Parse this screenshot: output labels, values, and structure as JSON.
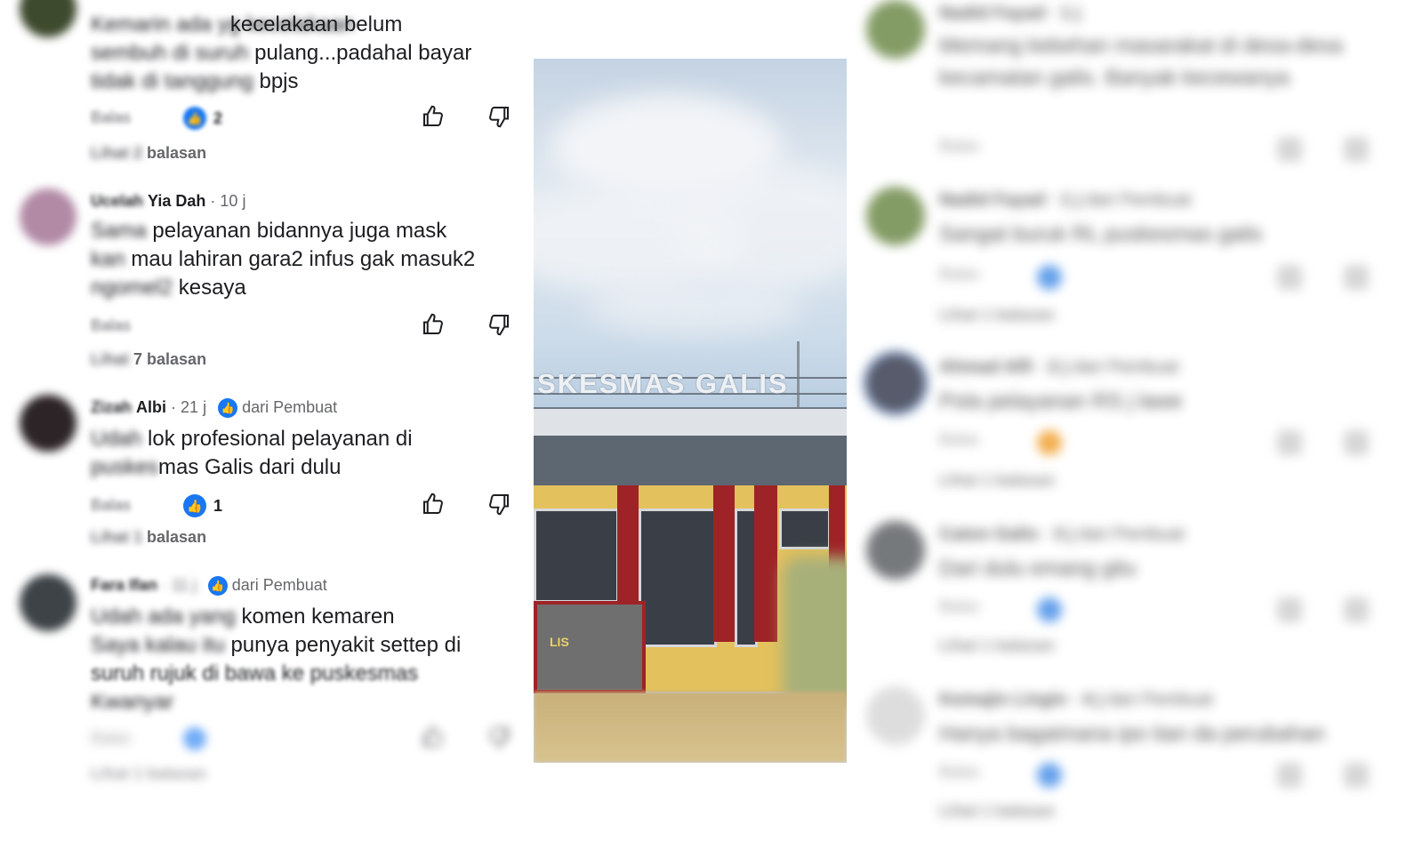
{
  "colors": {
    "accent": "#1877f2",
    "text": "#1c1e21",
    "muted": "#65676b"
  },
  "left_comments": [
    {
      "name": "",
      "time": "",
      "author_badge": "",
      "text_blur": "Kemarin ada yg kecelakaan",
      "text_clear_1": "kecelakaan belum",
      "text_blur_2": "sembuh di suruh",
      "text_clear_2": "pulang...padahal bayar",
      "text_blur_3": "tidak di tanggung",
      "text_clear_3": "bpjs",
      "reply_label": "Balas",
      "reaction_count": "2",
      "replies_blur": "Lihat 2",
      "replies_clear": "balasan"
    },
    {
      "name_blur": "Ucelah",
      "name_clear": "Yia Dah",
      "time": "· 10 j",
      "text_blur": "Sama",
      "text_clear_1": "pelayanan bidannya juga mask",
      "text_blur_2": "kan",
      "text_clear_2": "mau lahiran gara2 infus gak masuk2",
      "text_blur_3": "ngomel2",
      "text_clear_3": "kesaya",
      "reply_label": "Balas",
      "replies_blur": "Lihat",
      "replies_clear": "7 balasan"
    },
    {
      "name_blur": "Zizah",
      "name_clear": "Albi",
      "time": "· 21 j",
      "author_badge": "dari Pembuat",
      "text_blur": "Udah",
      "text_clear_1": "lok profesional pelayanan di",
      "text_blur_2": "puskes",
      "text_clear_2": "mas Galis dari dulu",
      "reply_label": "Balas",
      "reaction_count": "1",
      "replies_blur": "Lihat 1",
      "replies_clear": "balasan"
    },
    {
      "name_blur": "Fara Ifan",
      "time_blur": "· 11 j",
      "author_badge": "dari Pembuat",
      "text_blur": "Udah ada yang",
      "text_clear_1": "komen kemaren",
      "text_blur_2": "Saya kalau itu",
      "text_clear_2": "punya penyakit settep di",
      "text_blur_3": "suruh rujuk di bawa ke puskesmas",
      "text_clear_3": "",
      "text_blur_4": "Kwanyar",
      "reply_label": "Balas",
      "replies_blur": "Lihat 1 balasan"
    }
  ],
  "photo": {
    "sign_text": "SKESMAS GALIS",
    "plaque_text": "LIS"
  },
  "right_comments": [
    {
      "name": "Nadid Fayad",
      "time": "· 1 j",
      "text": "Memang kekehan masarakat di desa-desa kecamatan galis. Banyak kecewanya",
      "reply": "Balas"
    },
    {
      "name": "Nadid Fayad",
      "time": "· 1 j",
      "badge": "dari Pembuat",
      "text": "Sangat buruk RL puskesmas galis",
      "reply": "Balas",
      "replies": "Lihat 1 balasan"
    },
    {
      "name": "Ahmad Alfi",
      "time": "· 2 j",
      "badge": "dari Pembuat",
      "text": "Pola pelayanan RS j lawe",
      "reply": "Balas",
      "replies": "Lihat 1 balasan"
    },
    {
      "name": "Caton Galis",
      "time": "· 3 j",
      "badge": "dari Pembuat",
      "text": "Dari dulu emang gitu",
      "reply": "Balas",
      "replies": "Lihat 1 balasan"
    },
    {
      "name": "Kemajin Lingin",
      "time": "· 4 j",
      "badge": "dari Pembuat",
      "text": "Hanya bagaimana ipo tian da perubahan",
      "reply": "Balas",
      "replies": "Lihat 1 balasan"
    }
  ]
}
